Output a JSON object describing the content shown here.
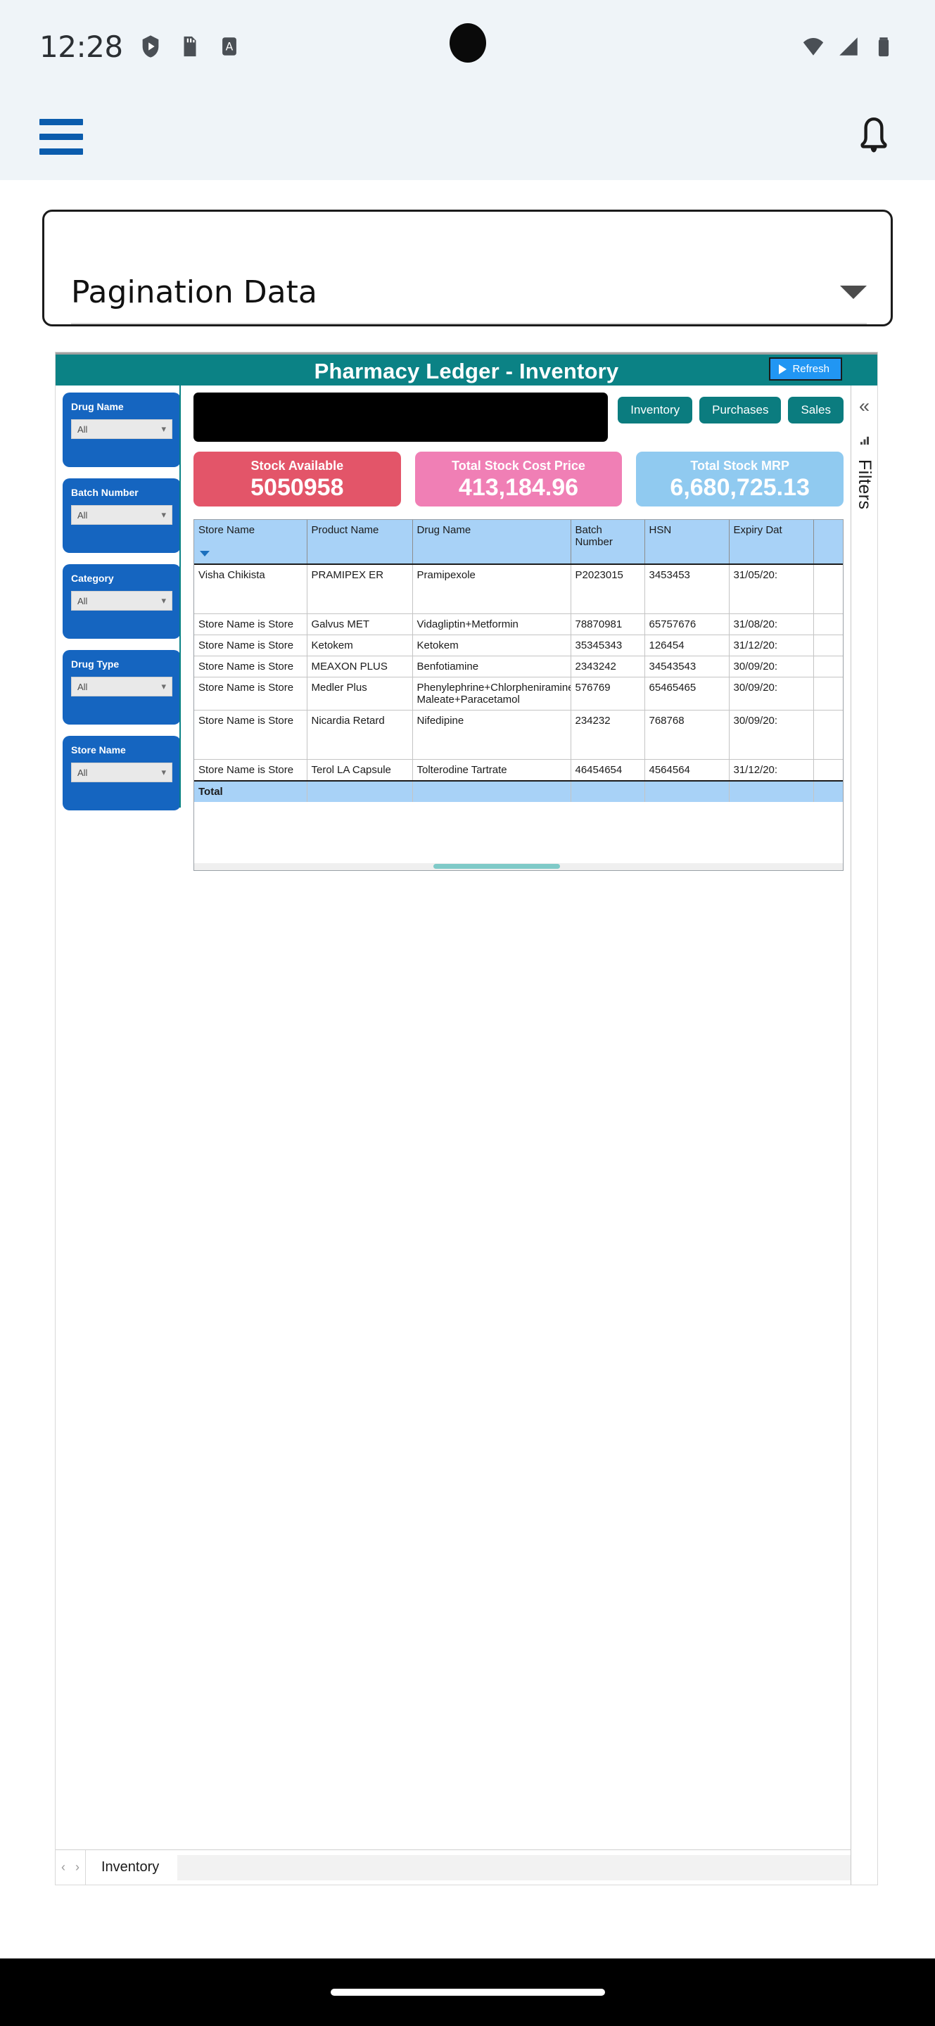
{
  "status_bar": {
    "time": "12:28",
    "icons": [
      "play-shield-icon",
      "sd-card-icon",
      "letter-a-icon"
    ],
    "right_icons": [
      "wifi-icon",
      "signal-icon",
      "battery-icon"
    ]
  },
  "app_header": {
    "menu_icon": "hamburger-menu-icon",
    "notification_icon": "bell-icon"
  },
  "dropdown": {
    "label": "Pagination Data",
    "caret_icon": "chevron-down-icon"
  },
  "report": {
    "title": "Pharmacy Ledger - Inventory",
    "refresh_label": "Refresh",
    "refresh_icon": "play-icon",
    "header_color": "#0b8285",
    "filters_rail": {
      "collapse_icon": "double-chevron-left-icon",
      "filter_icon": "filter-icon",
      "label": "Filters"
    },
    "slicers": [
      {
        "label": "Drug Name",
        "value": "All"
      },
      {
        "label": "Batch Number",
        "value": "All"
      },
      {
        "label": "Category",
        "value": "All"
      },
      {
        "label": "Drug Type",
        "value": "All"
      },
      {
        "label": "Store Name",
        "value": "All"
      }
    ],
    "tabs": [
      {
        "label": "Inventory"
      },
      {
        "label": "Purchases"
      },
      {
        "label": "Sales"
      }
    ],
    "kpis": [
      {
        "title": "Stock Available",
        "value": "5050958",
        "color": "#e35569"
      },
      {
        "title": "Total Stock Cost Price",
        "value": "413,184.96",
        "color": "#f07fb5"
      },
      {
        "title": "Total Stock MRP",
        "value": "6,680,725.13",
        "color": "#90caf0"
      }
    ],
    "table": {
      "columns": [
        "Store Name",
        "Product Name",
        "Drug Name",
        "Batch Number",
        "HSN",
        "Expiry Dat"
      ],
      "rows": [
        {
          "store": "Visha Chikista",
          "product": "PRAMIPEX ER",
          "drug": "Pramipexole",
          "batch": "P2023015",
          "hsn": "3453453",
          "expiry": "31/05/20:"
        },
        {
          "store": "Store Name is Store",
          "product": "Galvus MET",
          "drug": "Vidagliptin+Metformin",
          "batch": "78870981",
          "hsn": "65757676",
          "expiry": "31/08/20:"
        },
        {
          "store": "Store Name is Store",
          "product": "Ketokem",
          "drug": "Ketokem",
          "batch": "35345343",
          "hsn": "126454",
          "expiry": "31/12/20:"
        },
        {
          "store": "Store Name is Store",
          "product": "MEAXON PLUS",
          "drug": "Benfotiamine",
          "batch": "2343242",
          "hsn": "34543543",
          "expiry": "30/09/20:"
        },
        {
          "store": "Store Name is Store",
          "product": "Medler Plus",
          "drug": "Phenylephrine+Chlorpheniramine Maleate+Paracetamol",
          "batch": "576769",
          "hsn": "65465465",
          "expiry": "30/09/20:"
        },
        {
          "store": "Store Name is Store",
          "product": "Nicardia Retard",
          "drug": "Nifedipine",
          "batch": "234232",
          "hsn": "768768",
          "expiry": "30/09/20:"
        },
        {
          "store": "Store Name is Store",
          "product": "Terol LA Capsule",
          "drug": "Tolterodine Tartrate",
          "batch": "46454654",
          "hsn": "4564564",
          "expiry": "31/12/20:"
        }
      ],
      "total_label": "Total"
    },
    "page_bar": {
      "prev_icon": "chevron-left-icon",
      "next_icon": "chevron-right-icon",
      "page_tab": "Inventory"
    }
  }
}
